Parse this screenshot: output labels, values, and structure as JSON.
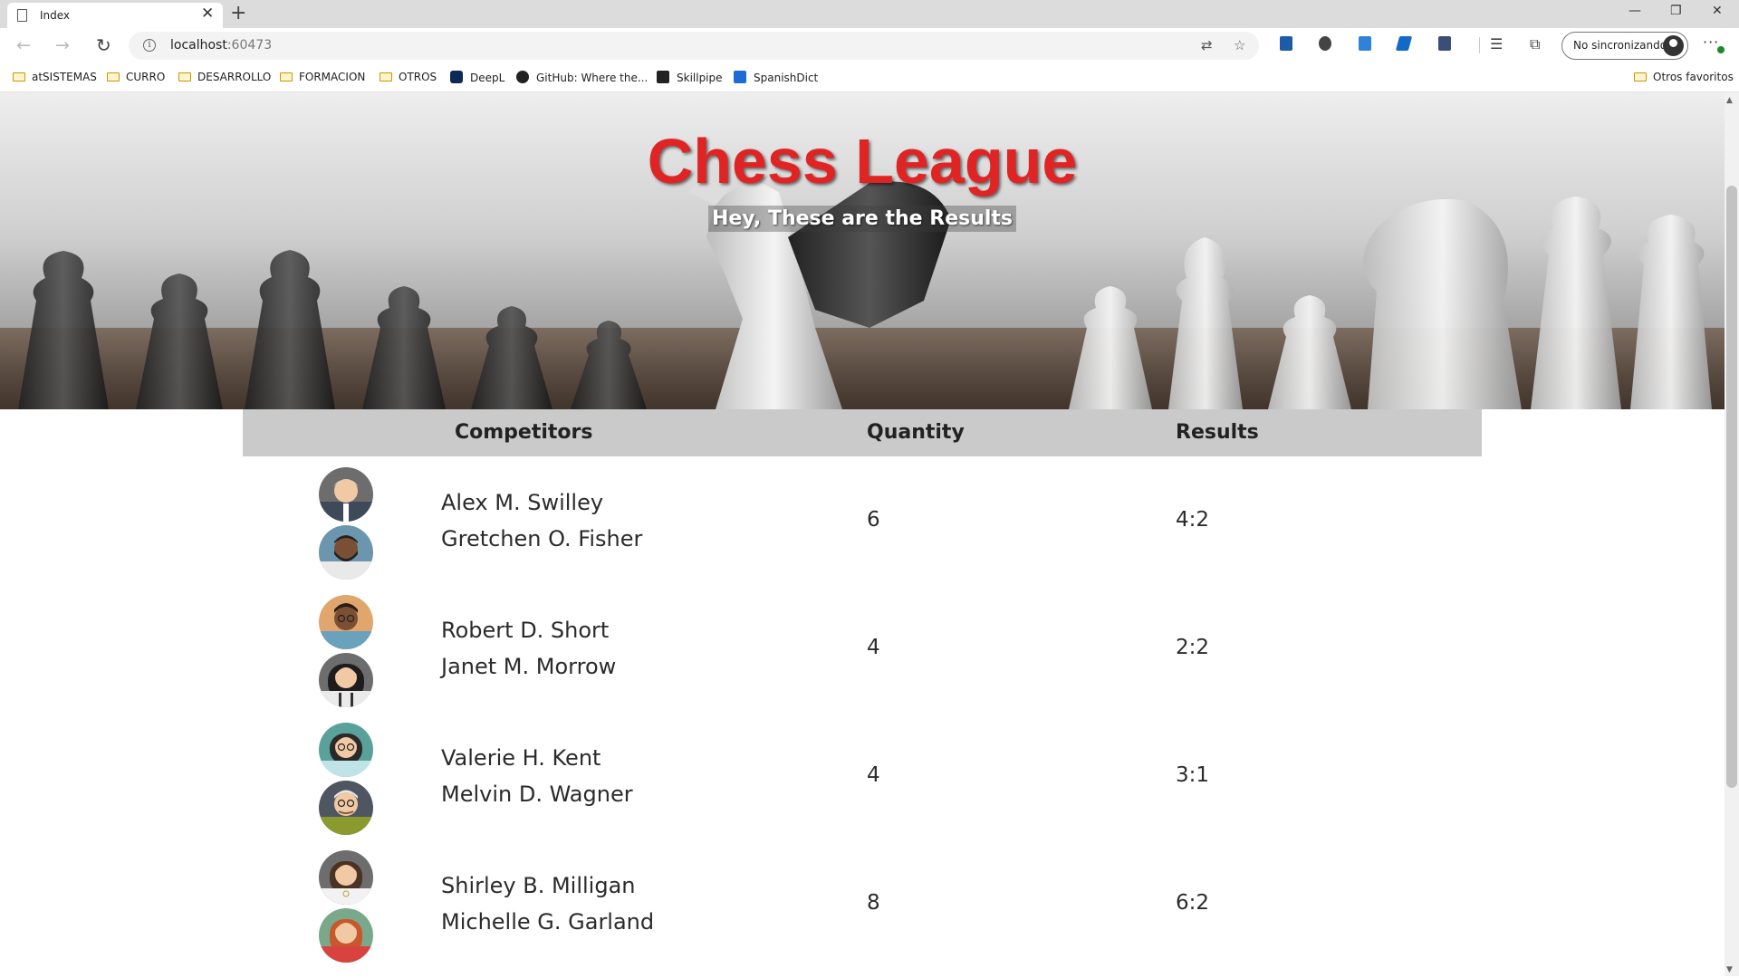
{
  "browser": {
    "tab_title": "Index",
    "tab_close": "✕",
    "new_tab": "+",
    "url_host": "localhost",
    "url_port": ":60473",
    "profile_label": "No sincronizando",
    "more": "···",
    "window_minimize": "—",
    "window_restore": "❐",
    "window_close": "✕"
  },
  "bookmarks": {
    "items": [
      {
        "label": "atSISTEMAS",
        "type": "folder"
      },
      {
        "label": "CURRO",
        "type": "folder"
      },
      {
        "label": "DESARROLLO",
        "type": "folder"
      },
      {
        "label": "FORMACION",
        "type": "folder"
      },
      {
        "label": "OTROS",
        "type": "folder"
      },
      {
        "label": "DeepL",
        "type": "link",
        "icon": "deepl-icon"
      },
      {
        "label": "GitHub: Where the...",
        "type": "link",
        "icon": "github-icon"
      },
      {
        "label": "Skillpipe",
        "type": "link",
        "icon": "skillpipe-icon"
      },
      {
        "label": "SpanishDict",
        "type": "link",
        "icon": "spanishdict-icon"
      }
    ],
    "other_favorites": "Otros favoritos"
  },
  "hero": {
    "title": "Chess League",
    "subtitle": "Hey, These are the Results",
    "title_color": "#e02424"
  },
  "table": {
    "headers": {
      "competitors": "Competitors",
      "quantity": "Quantity",
      "results": "Results"
    },
    "header_bg": "#cacaca",
    "rows": [
      {
        "player1": "Alex M. Swilley",
        "player2": "Gretchen O. Fisher",
        "quantity": "6",
        "result": "4:2",
        "avatar1": "elderly-man-avatar",
        "avatar2": "bearded-man-avatar"
      },
      {
        "player1": "Robert D. Short",
        "player2": "Janet M. Morrow",
        "quantity": "4",
        "result": "2:2",
        "avatar1": "man-with-glasses-avatar",
        "avatar2": "woman-dark-hair-avatar"
      },
      {
        "player1": "Valerie H. Kent",
        "player2": "Melvin D. Wagner",
        "quantity": "4",
        "result": "3:1",
        "avatar1": "woman-with-glasses-avatar",
        "avatar2": "elderly-man-glasses-avatar"
      },
      {
        "player1": "Shirley B. Milligan",
        "player2": "Michelle G. Garland",
        "quantity": "8",
        "result": "6:2",
        "avatar1": "woman-brown-hair-avatar",
        "avatar2": "redhead-woman-avatar"
      }
    ]
  }
}
